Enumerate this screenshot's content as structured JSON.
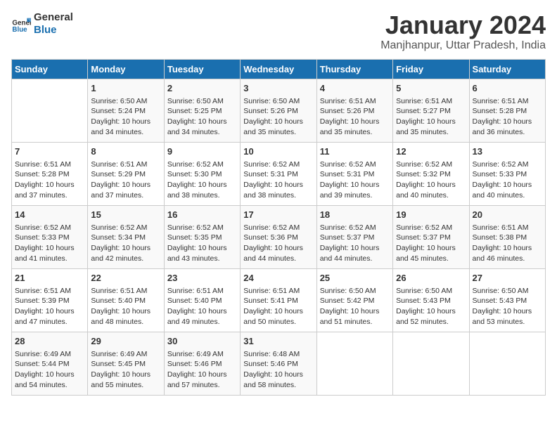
{
  "logo": {
    "text_general": "General",
    "text_blue": "Blue"
  },
  "title": "January 2024",
  "subtitle": "Manjhanpur, Uttar Pradesh, India",
  "days_of_week": [
    "Sunday",
    "Monday",
    "Tuesday",
    "Wednesday",
    "Thursday",
    "Friday",
    "Saturday"
  ],
  "weeks": [
    [
      {
        "day": "",
        "info": ""
      },
      {
        "day": "1",
        "info": "Sunrise: 6:50 AM\nSunset: 5:24 PM\nDaylight: 10 hours\nand 34 minutes."
      },
      {
        "day": "2",
        "info": "Sunrise: 6:50 AM\nSunset: 5:25 PM\nDaylight: 10 hours\nand 34 minutes."
      },
      {
        "day": "3",
        "info": "Sunrise: 6:50 AM\nSunset: 5:26 PM\nDaylight: 10 hours\nand 35 minutes."
      },
      {
        "day": "4",
        "info": "Sunrise: 6:51 AM\nSunset: 5:26 PM\nDaylight: 10 hours\nand 35 minutes."
      },
      {
        "day": "5",
        "info": "Sunrise: 6:51 AM\nSunset: 5:27 PM\nDaylight: 10 hours\nand 35 minutes."
      },
      {
        "day": "6",
        "info": "Sunrise: 6:51 AM\nSunset: 5:28 PM\nDaylight: 10 hours\nand 36 minutes."
      }
    ],
    [
      {
        "day": "7",
        "info": "Sunrise: 6:51 AM\nSunset: 5:28 PM\nDaylight: 10 hours\nand 37 minutes."
      },
      {
        "day": "8",
        "info": "Sunrise: 6:51 AM\nSunset: 5:29 PM\nDaylight: 10 hours\nand 37 minutes."
      },
      {
        "day": "9",
        "info": "Sunrise: 6:52 AM\nSunset: 5:30 PM\nDaylight: 10 hours\nand 38 minutes."
      },
      {
        "day": "10",
        "info": "Sunrise: 6:52 AM\nSunset: 5:31 PM\nDaylight: 10 hours\nand 38 minutes."
      },
      {
        "day": "11",
        "info": "Sunrise: 6:52 AM\nSunset: 5:31 PM\nDaylight: 10 hours\nand 39 minutes."
      },
      {
        "day": "12",
        "info": "Sunrise: 6:52 AM\nSunset: 5:32 PM\nDaylight: 10 hours\nand 40 minutes."
      },
      {
        "day": "13",
        "info": "Sunrise: 6:52 AM\nSunset: 5:33 PM\nDaylight: 10 hours\nand 40 minutes."
      }
    ],
    [
      {
        "day": "14",
        "info": "Sunrise: 6:52 AM\nSunset: 5:33 PM\nDaylight: 10 hours\nand 41 minutes."
      },
      {
        "day": "15",
        "info": "Sunrise: 6:52 AM\nSunset: 5:34 PM\nDaylight: 10 hours\nand 42 minutes."
      },
      {
        "day": "16",
        "info": "Sunrise: 6:52 AM\nSunset: 5:35 PM\nDaylight: 10 hours\nand 43 minutes."
      },
      {
        "day": "17",
        "info": "Sunrise: 6:52 AM\nSunset: 5:36 PM\nDaylight: 10 hours\nand 44 minutes."
      },
      {
        "day": "18",
        "info": "Sunrise: 6:52 AM\nSunset: 5:37 PM\nDaylight: 10 hours\nand 44 minutes."
      },
      {
        "day": "19",
        "info": "Sunrise: 6:52 AM\nSunset: 5:37 PM\nDaylight: 10 hours\nand 45 minutes."
      },
      {
        "day": "20",
        "info": "Sunrise: 6:51 AM\nSunset: 5:38 PM\nDaylight: 10 hours\nand 46 minutes."
      }
    ],
    [
      {
        "day": "21",
        "info": "Sunrise: 6:51 AM\nSunset: 5:39 PM\nDaylight: 10 hours\nand 47 minutes."
      },
      {
        "day": "22",
        "info": "Sunrise: 6:51 AM\nSunset: 5:40 PM\nDaylight: 10 hours\nand 48 minutes."
      },
      {
        "day": "23",
        "info": "Sunrise: 6:51 AM\nSunset: 5:40 PM\nDaylight: 10 hours\nand 49 minutes."
      },
      {
        "day": "24",
        "info": "Sunrise: 6:51 AM\nSunset: 5:41 PM\nDaylight: 10 hours\nand 50 minutes."
      },
      {
        "day": "25",
        "info": "Sunrise: 6:50 AM\nSunset: 5:42 PM\nDaylight: 10 hours\nand 51 minutes."
      },
      {
        "day": "26",
        "info": "Sunrise: 6:50 AM\nSunset: 5:43 PM\nDaylight: 10 hours\nand 52 minutes."
      },
      {
        "day": "27",
        "info": "Sunrise: 6:50 AM\nSunset: 5:43 PM\nDaylight: 10 hours\nand 53 minutes."
      }
    ],
    [
      {
        "day": "28",
        "info": "Sunrise: 6:49 AM\nSunset: 5:44 PM\nDaylight: 10 hours\nand 54 minutes."
      },
      {
        "day": "29",
        "info": "Sunrise: 6:49 AM\nSunset: 5:45 PM\nDaylight: 10 hours\nand 55 minutes."
      },
      {
        "day": "30",
        "info": "Sunrise: 6:49 AM\nSunset: 5:46 PM\nDaylight: 10 hours\nand 57 minutes."
      },
      {
        "day": "31",
        "info": "Sunrise: 6:48 AM\nSunset: 5:46 PM\nDaylight: 10 hours\nand 58 minutes."
      },
      {
        "day": "",
        "info": ""
      },
      {
        "day": "",
        "info": ""
      },
      {
        "day": "",
        "info": ""
      }
    ]
  ]
}
